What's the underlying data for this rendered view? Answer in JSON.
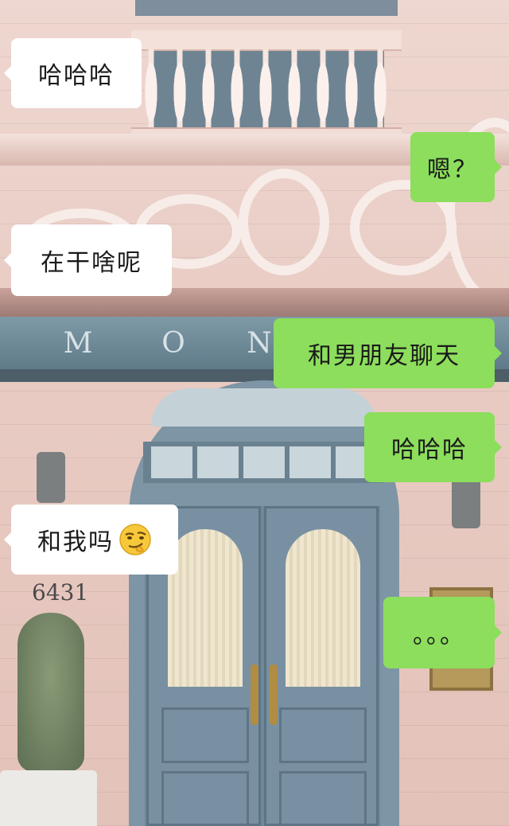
{
  "chat": {
    "messages": [
      {
        "side": "incoming",
        "text": "哈哈哈"
      },
      {
        "side": "outgoing",
        "text": "嗯？"
      },
      {
        "side": "incoming",
        "text": "在干啥呢"
      },
      {
        "side": "outgoing",
        "text": "和男朋友聊天"
      },
      {
        "side": "outgoing",
        "text": "哈哈哈"
      },
      {
        "side": "incoming",
        "text": "和我吗",
        "emoji": "smirk-emoji"
      },
      {
        "side": "outgoing",
        "text": "。。。"
      }
    ]
  },
  "background": {
    "sign_letters": [
      "M",
      "O",
      "N"
    ],
    "address_number": "6431"
  },
  "colors": {
    "incoming_bubble": "#ffffff",
    "outgoing_bubble": "#8cde5c"
  }
}
